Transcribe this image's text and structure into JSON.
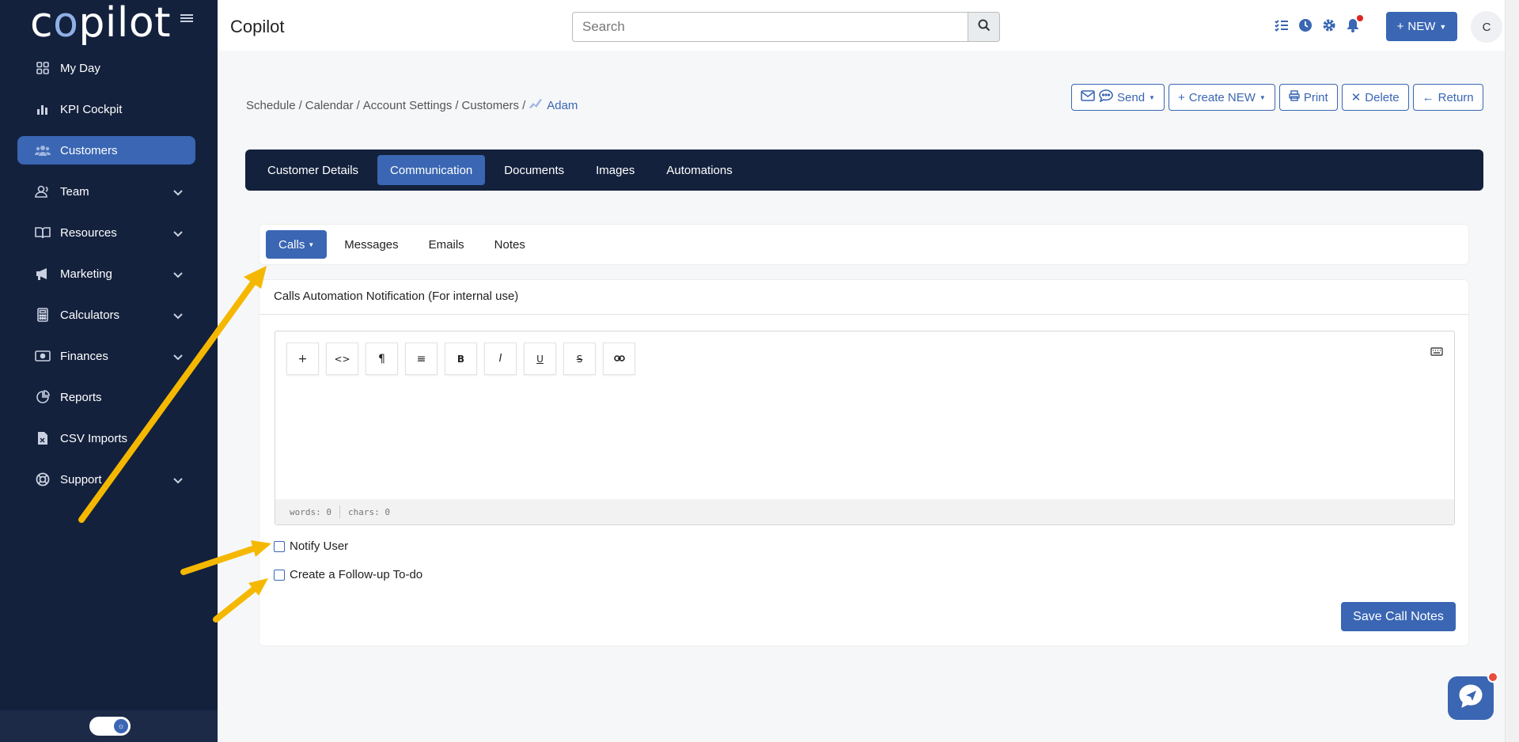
{
  "brand": {
    "logo_text": "copilot",
    "app_title": "Copilot"
  },
  "sidebar": {
    "items": [
      {
        "label": "My Day",
        "icon": "grid-icon",
        "active": false,
        "expandable": false
      },
      {
        "label": "KPI Cockpit",
        "icon": "bar-chart-icon",
        "active": false,
        "expandable": false
      },
      {
        "label": "Customers",
        "icon": "users-icon",
        "active": true,
        "expandable": false
      },
      {
        "label": "Team",
        "icon": "user-icon",
        "active": false,
        "expandable": true
      },
      {
        "label": "Resources",
        "icon": "book-icon",
        "active": false,
        "expandable": true
      },
      {
        "label": "Marketing",
        "icon": "megaphone-icon",
        "active": false,
        "expandable": true
      },
      {
        "label": "Calculators",
        "icon": "calculator-icon",
        "active": false,
        "expandable": true
      },
      {
        "label": "Finances",
        "icon": "money-icon",
        "active": false,
        "expandable": true
      },
      {
        "label": "Reports",
        "icon": "pie-chart-icon",
        "active": false,
        "expandable": false
      },
      {
        "label": "CSV Imports",
        "icon": "file-csv-icon",
        "active": false,
        "expandable": false
      },
      {
        "label": "Support",
        "icon": "lifebuoy-icon",
        "active": false,
        "expandable": true
      }
    ]
  },
  "topbar": {
    "search_placeholder": "Search",
    "new_label": "NEW",
    "avatar_initial": "C"
  },
  "breadcrumb": {
    "items": [
      "Schedule",
      "Calendar",
      "Account Settings",
      "Customers"
    ],
    "current": "Adam",
    "separator": "/"
  },
  "actions": {
    "send": "Send",
    "create_new": "Create NEW",
    "print": "Print",
    "delete": "Delete",
    "return": "Return"
  },
  "main_tabs": [
    {
      "label": "Customer Details",
      "active": false
    },
    {
      "label": "Communication",
      "active": true
    },
    {
      "label": "Documents",
      "active": false
    },
    {
      "label": "Images",
      "active": false
    },
    {
      "label": "Automations",
      "active": false
    }
  ],
  "sub_tabs": [
    {
      "label": "Calls",
      "active": true
    },
    {
      "label": "Messages",
      "active": false
    },
    {
      "label": "Emails",
      "active": false
    },
    {
      "label": "Notes",
      "active": false
    }
  ],
  "card": {
    "title": "Calls Automation Notification (For internal use)",
    "editor": {
      "toolbar": [
        "+",
        "<>",
        "¶",
        "≡",
        "B",
        "I",
        "U",
        "S",
        "🔗"
      ],
      "words_label": "words: 0",
      "chars_label": "chars: 0"
    },
    "notify_user_label": "Notify User",
    "follow_up_label": "Create a Follow-up To-do",
    "save_label": "Save Call Notes"
  },
  "colors": {
    "sidebar_bg": "#14213d",
    "accent": "#3a66b3",
    "annotation_arrow": "#f5b800"
  }
}
